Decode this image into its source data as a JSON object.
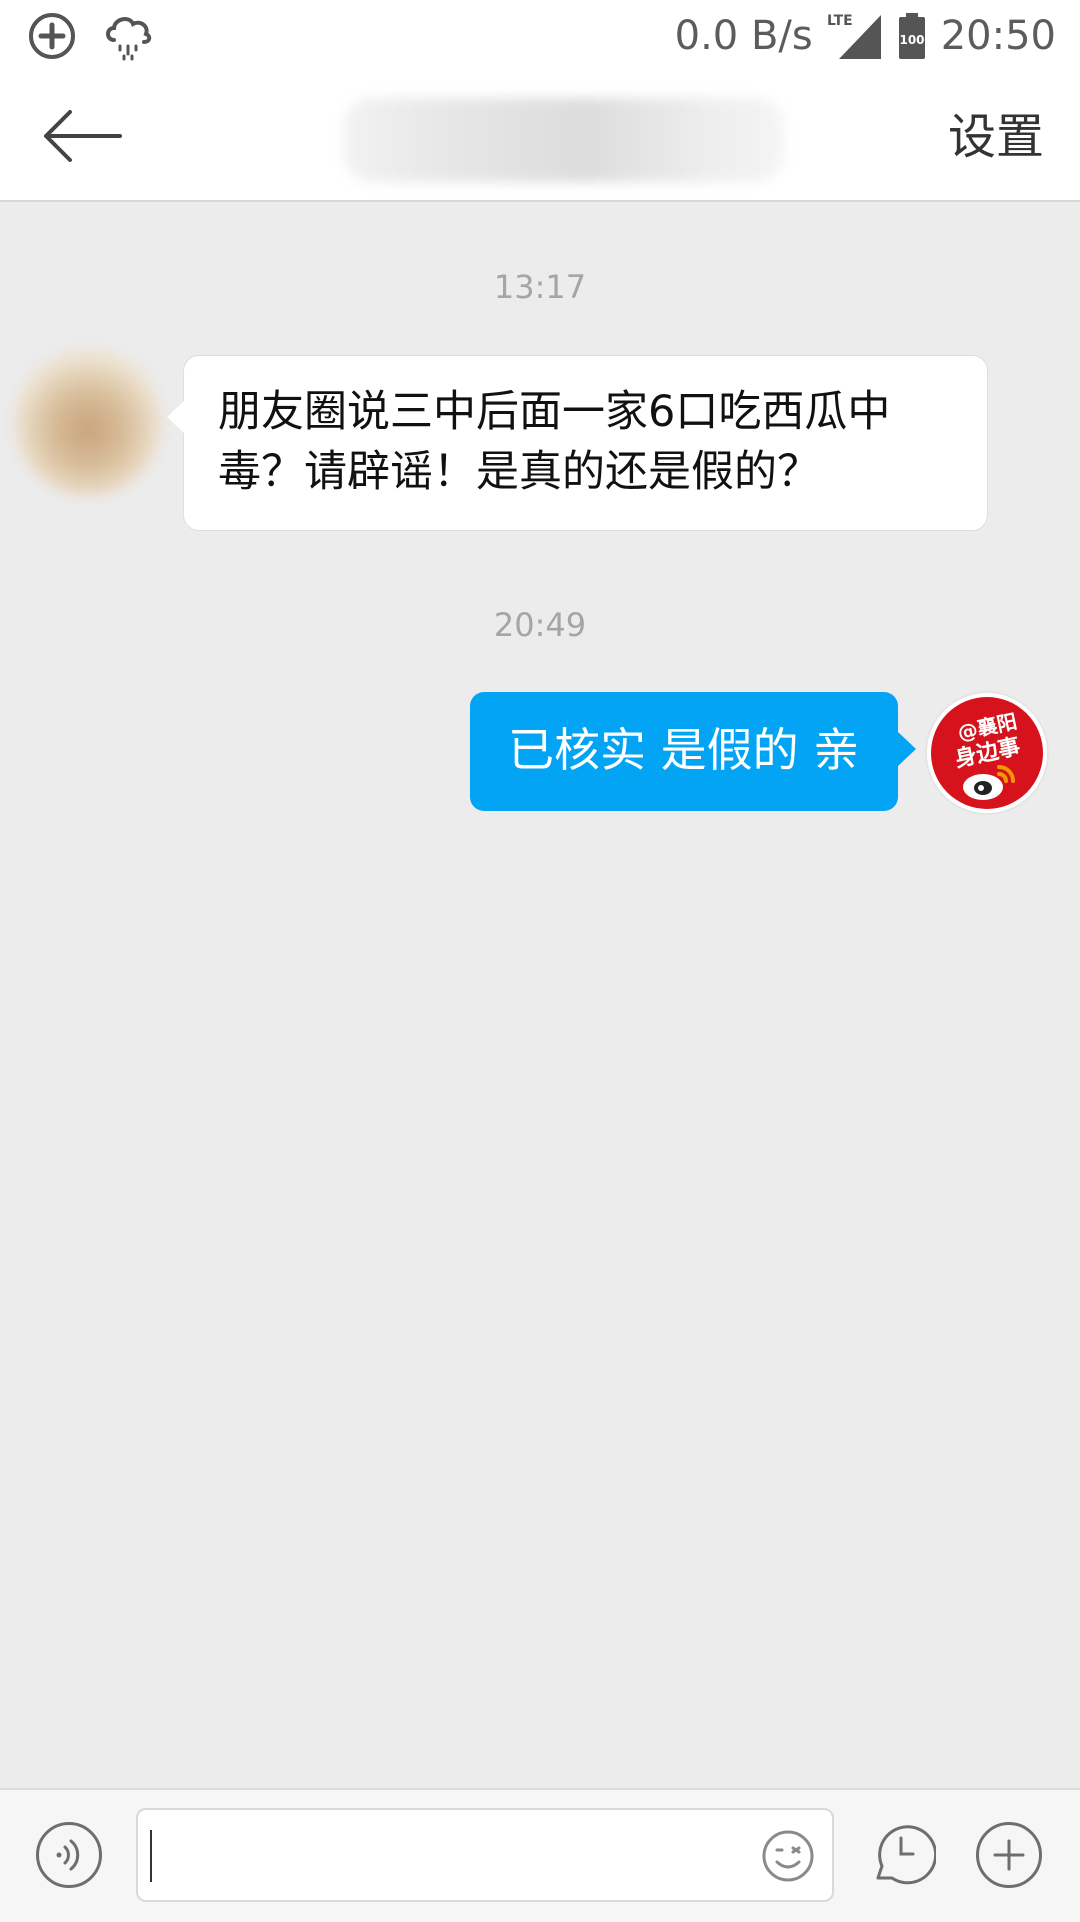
{
  "status_bar": {
    "network_speed": "0.0 B/s",
    "network_type": "LTE",
    "battery": "100",
    "time": "20:50",
    "icons": [
      "data-saver-icon",
      "weather-rain-icon",
      "lte-signal-icon",
      "battery-icon"
    ]
  },
  "header": {
    "back_icon": "arrow-left-icon",
    "title": "",
    "settings_label": "设置"
  },
  "messages": [
    {
      "timestamp": "13:17",
      "side": "left",
      "text": "朋友圈说三中后面一家6口吃西瓜中毒？请辟谣！是真的还是假的？"
    },
    {
      "timestamp": "20:49",
      "side": "right",
      "text": "已核实 是假的 亲",
      "avatar_text": [
        "@襄阳",
        "身边事"
      ]
    }
  ],
  "input_bar": {
    "voice_icon": "voice-icon",
    "input_value": "",
    "emoji_icon": "emoji-icon",
    "recent_icon": "clock-icon",
    "plus_icon": "plus-icon"
  },
  "colors": {
    "sent_bubble": "#03a4f4",
    "background": "#ececec",
    "avatar_red": "#d6121d"
  }
}
